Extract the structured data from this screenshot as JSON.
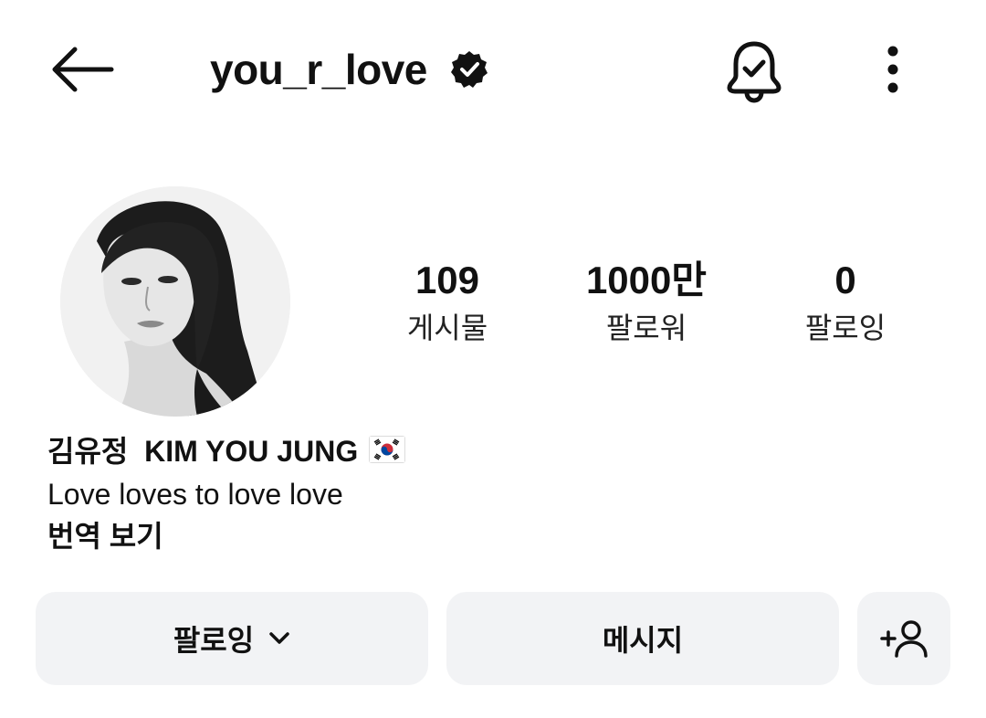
{
  "header": {
    "username": "you_r_love",
    "verified_icon": "verified-badge-icon",
    "back_icon": "arrow-left-icon",
    "notifications_icon": "bell-check-icon",
    "more_icon": "more-vertical-icon"
  },
  "profile": {
    "avatar_icon": "profile-photo",
    "stats": [
      {
        "value": "109",
        "label": "게시물"
      },
      {
        "value": "1000만",
        "label": "팔로워"
      },
      {
        "value": "0",
        "label": "팔로잉"
      }
    ],
    "display_name": "김유정  KIM YOU JUNG",
    "flag_icon": "south-korea-flag-icon",
    "bio": "Love loves to love love",
    "translate_label": "번역 보기"
  },
  "actions": {
    "following_label": "팔로잉",
    "following_chevron_icon": "chevron-down-icon",
    "message_label": "메시지",
    "suggest_icon": "add-person-icon"
  },
  "colors": {
    "button_bg": "#f2f3f5",
    "text": "#111111"
  }
}
